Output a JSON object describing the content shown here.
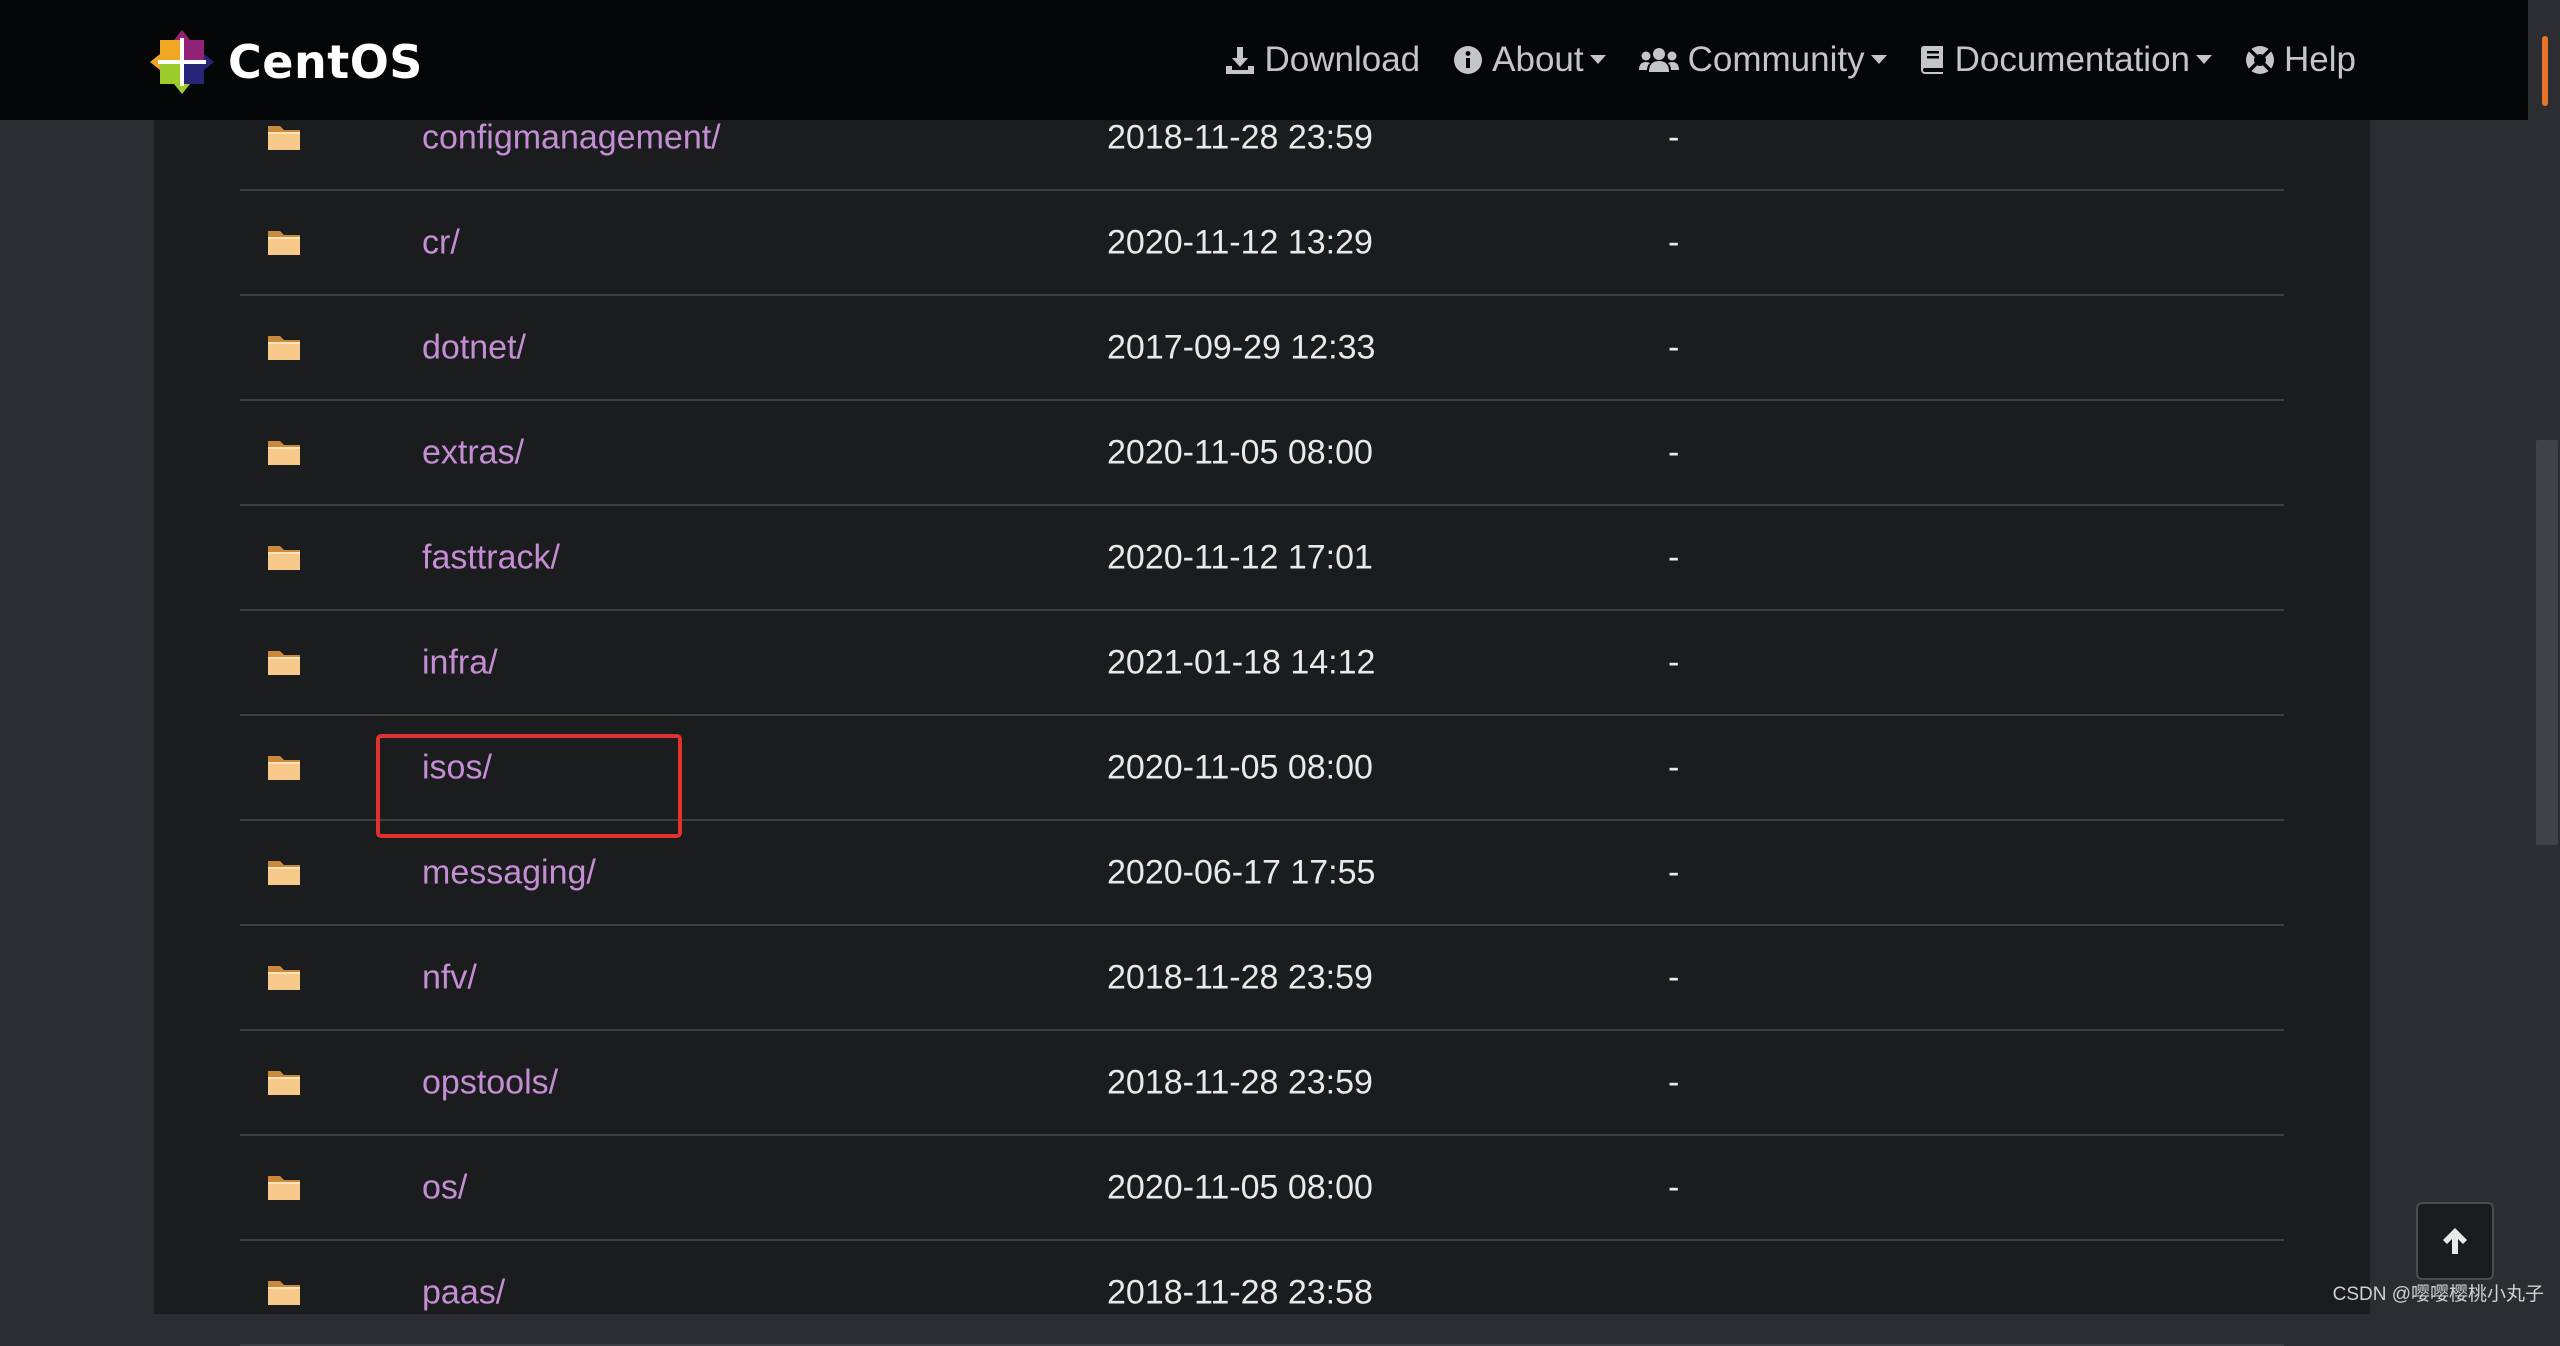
{
  "header": {
    "brand": "CentOS",
    "nav": [
      {
        "label": "Download",
        "icon": "download-icon",
        "dropdown": false
      },
      {
        "label": "About",
        "icon": "info-icon",
        "dropdown": true
      },
      {
        "label": "Community",
        "icon": "users-icon",
        "dropdown": true
      },
      {
        "label": "Documentation",
        "icon": "book-icon",
        "dropdown": true
      },
      {
        "label": "Help",
        "icon": "lifebuoy-icon",
        "dropdown": false
      }
    ]
  },
  "listing": {
    "rows": [
      {
        "name": "configmanagement/",
        "date": "2018-11-28 23:59",
        "size": "-"
      },
      {
        "name": "cr/",
        "date": "2020-11-12 13:29",
        "size": "-"
      },
      {
        "name": "dotnet/",
        "date": "2017-09-29 12:33",
        "size": "-"
      },
      {
        "name": "extras/",
        "date": "2020-11-05 08:00",
        "size": "-"
      },
      {
        "name": "fasttrack/",
        "date": "2020-11-12 17:01",
        "size": "-"
      },
      {
        "name": "infra/",
        "date": "2021-01-18 14:12",
        "size": "-"
      },
      {
        "name": "isos/",
        "date": "2020-11-05 08:00",
        "size": "-",
        "highlighted": true
      },
      {
        "name": "messaging/",
        "date": "2020-06-17 17:55",
        "size": "-"
      },
      {
        "name": "nfv/",
        "date": "2018-11-28 23:59",
        "size": "-"
      },
      {
        "name": "opstools/",
        "date": "2018-11-28 23:59",
        "size": "-"
      },
      {
        "name": "os/",
        "date": "2020-11-05 08:00",
        "size": "-"
      },
      {
        "name": "paas/",
        "date": "2018-11-28 23:58",
        "size": ""
      }
    ]
  },
  "colors": {
    "link": "#c58dd4",
    "highlight": "#e0312e",
    "header_bg": "#050608",
    "panel_bg": "#1b1c1e",
    "scroll_marker": "#e8742c"
  },
  "watermark": "CSDN @嘤嘤樱桃小丸子"
}
